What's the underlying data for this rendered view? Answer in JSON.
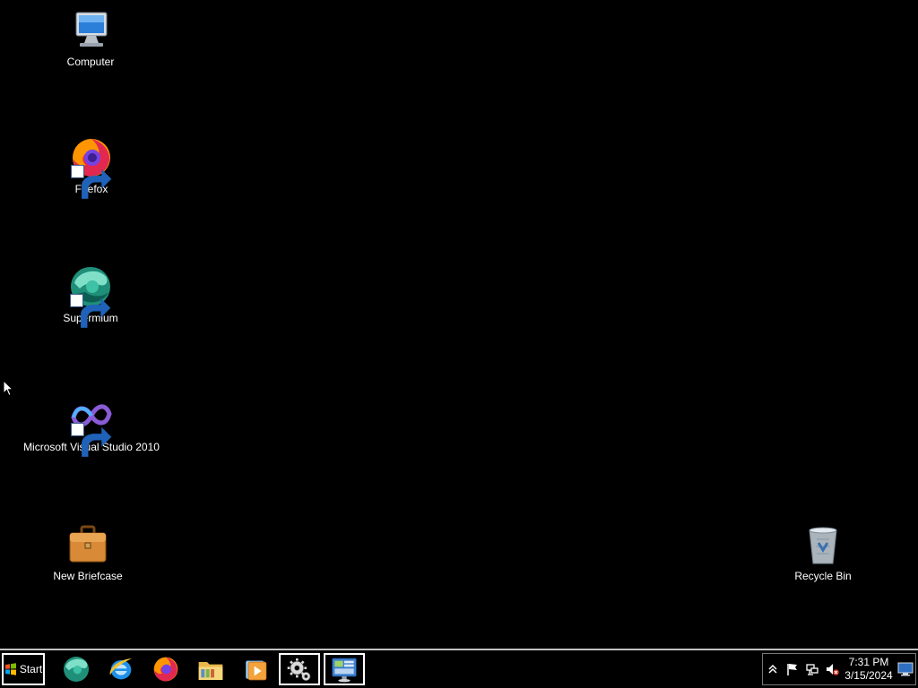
{
  "desktop": {
    "icons": [
      {
        "label": "Computer",
        "icon": "computer-icon"
      },
      {
        "label": "Firefox",
        "icon": "firefox-icon"
      },
      {
        "label": "Supermium",
        "icon": "supermium-icon"
      },
      {
        "label": "Microsoft Visual Studio 2010",
        "icon": "visual-studio-icon"
      },
      {
        "label": "New Briefcase",
        "icon": "briefcase-icon"
      },
      {
        "label": "Recycle Bin",
        "icon": "recycle-bin-icon"
      }
    ]
  },
  "taskbar": {
    "start_label": "Start",
    "pinned": [
      {
        "name": "supermium-taskbar-icon",
        "icon": "supermium-icon"
      },
      {
        "name": "internet-explorer-taskbar-icon",
        "icon": "ie-icon"
      },
      {
        "name": "firefox-taskbar-icon",
        "icon": "firefox-icon"
      },
      {
        "name": "explorer-taskbar-icon",
        "icon": "folder-icon"
      },
      {
        "name": "media-player-taskbar-icon",
        "icon": "media-player-icon"
      },
      {
        "name": "settings-taskbar-icon",
        "icon": "gear-icon",
        "active": true
      },
      {
        "name": "control-panel-taskbar-icon",
        "icon": "control-panel-icon",
        "active": true
      }
    ],
    "tray": {
      "time": "7:31 PM",
      "date": "3/15/2024",
      "icons": [
        "chevron-up-icon",
        "flag-icon",
        "network-icon",
        "volume-muted-icon"
      ]
    }
  },
  "colors": {
    "background": "#000000",
    "taskbar_border": "#c0c0c0",
    "text": "#ffffff"
  }
}
